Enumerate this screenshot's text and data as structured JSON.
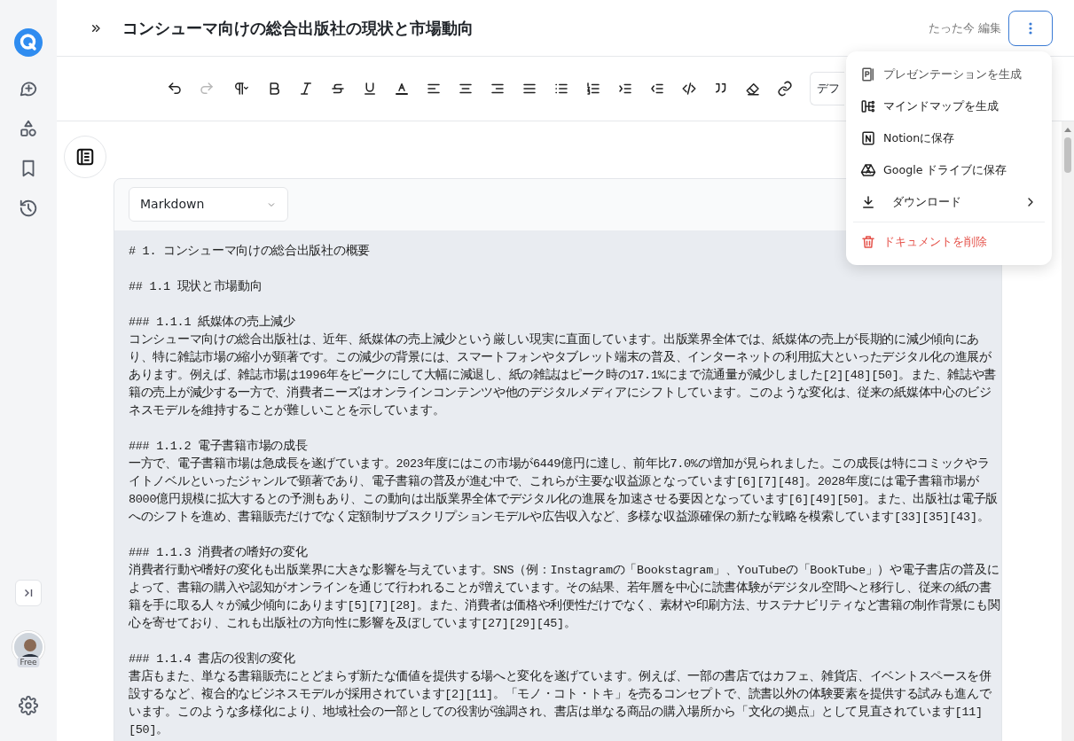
{
  "header": {
    "title": "コンシューマ向けの総合出版社の現状と市場動向",
    "edited": "たった今 編集"
  },
  "toolbar": [
    {
      "kind": "undo",
      "disabled": false
    },
    {
      "kind": "redo",
      "disabled": true
    },
    {
      "kind": "paragraph",
      "disabled": false
    },
    {
      "kind": "bold",
      "disabled": false
    },
    {
      "kind": "italic",
      "disabled": false
    },
    {
      "kind": "strike",
      "disabled": false
    },
    {
      "kind": "underline",
      "disabled": false
    },
    {
      "kind": "color",
      "disabled": false
    },
    {
      "kind": "align-left",
      "disabled": false
    },
    {
      "kind": "align-center",
      "disabled": false
    },
    {
      "kind": "align-right",
      "disabled": false
    },
    {
      "kind": "justify",
      "disabled": false
    },
    {
      "kind": "bullets",
      "disabled": false
    },
    {
      "kind": "numbers",
      "disabled": false
    },
    {
      "kind": "indent",
      "disabled": false
    },
    {
      "kind": "outdent",
      "disabled": false
    },
    {
      "kind": "code",
      "disabled": false
    },
    {
      "kind": "quote",
      "disabled": false
    },
    {
      "kind": "eraser",
      "disabled": false
    },
    {
      "kind": "link",
      "disabled": false
    }
  ],
  "font_select": {
    "value": "デフ"
  },
  "menu": [
    {
      "kind": "presentation",
      "label": "プレゼンテーションを生成"
    },
    {
      "kind": "mindmap",
      "label": "マインドマップを生成"
    },
    {
      "kind": "notion",
      "label": "Notionに保存"
    },
    {
      "kind": "drive",
      "label": "Google ドライブに保存"
    },
    {
      "kind": "download",
      "label": "ダウンロード"
    },
    {
      "kind": "delete",
      "label": "ドキュメントを削除"
    }
  ],
  "editor": {
    "format": "Markdown",
    "sections": [
      {
        "heading": "# 1. コンシューマ向けの総合出版社の概要"
      },
      {
        "heading": "## 1.1 現状と市場動向"
      },
      {
        "heading": "### 1.1.1 紙媒体の売上減少",
        "body": "コンシューマ向けの総合出版社は、近年、紙媒体の売上減少という厳しい現実に直面しています。出版業界全体では、紙媒体の売上が長期的に減少傾向にあり、特に雑誌市場の縮小が顕著です。この減少の背景には、スマートフォンやタブレット端末の普及、インターネットの利用拡大といったデジタル化の進展があります。例えば、雑誌市場は1996年をピークにして大幅に減退し、紙の雑誌はピーク時の17.1%にまで流通量が減少しました[2][48][50]。また、雑誌や書籍の売上が減少する一方で、消費者ニーズはオンラインコンテンツや他のデジタルメディアにシフトしています。このような変化は、従来の紙媒体中心のビジネスモデルを維持することが難しいことを示しています。"
      },
      {
        "heading": "### 1.1.2 電子書籍市場の成長",
        "body": "一方で、電子書籍市場は急成長を遂げています。2023年度にはこの市場が6449億円に達し、前年比7.0%の増加が見られました。この成長は特にコミックやライトノベルといったジャンルで顕著であり、電子書籍の普及が進む中で、これらが主要な収益源となっています[6][7][48]。2028年度には電子書籍市場が8000億円規模に拡大するとの予測もあり、この動向は出版業界全体でデジタル化の進展を加速させる要因となっています[6][49][50]。また、出版社は電子版へのシフトを進め、書籍販売だけでなく定額制サブスクリプションモデルや広告収入など、多様な収益源確保の新たな戦略を模索しています[33][35][43]。"
      },
      {
        "heading": "### 1.1.3 消費者の嗜好の変化",
        "body": "消費者行動や嗜好の変化も出版業界に大きな影響を与えています。SNS（例：Instagramの「Bookstagram」、YouTubeの「BookTube」）や電子書店の普及によって、書籍の購入や認知がオンラインを通じて行われることが増えています。その結果、若年層を中心に読書体験がデジタル空間へと移行し、従来の紙の書籍を手に取る人々が減少傾向にあります[5][7][28]。また、消費者は価格や利便性だけでなく、素材や印刷方法、サステナビリティなど書籍の制作背景にも関心を寄せており、これも出版社の方向性に影響を及ぼしています[27][29][45]。"
      },
      {
        "heading": "### 1.1.4 書店の役割の変化",
        "body": "書店もまた、単なる書籍販売にとどまらず新たな価値を提供する場へと変化を遂げています。例えば、一部の書店ではカフェ、雑貨店、イベントスペースを併設するなど、複合的なビジネスモデルが採用されています[2][11]。「モノ・コト・トキ」を売るコンセプトで、読書以外の体験要素を提供する試みも進んでいます。このような多様化により、地域社会の一部としての役割が強調され、書店は単なる商品の購入場所から「文化の拠点」として見直されています[11][50]。"
      }
    ]
  },
  "account": {
    "plan": "Free"
  }
}
